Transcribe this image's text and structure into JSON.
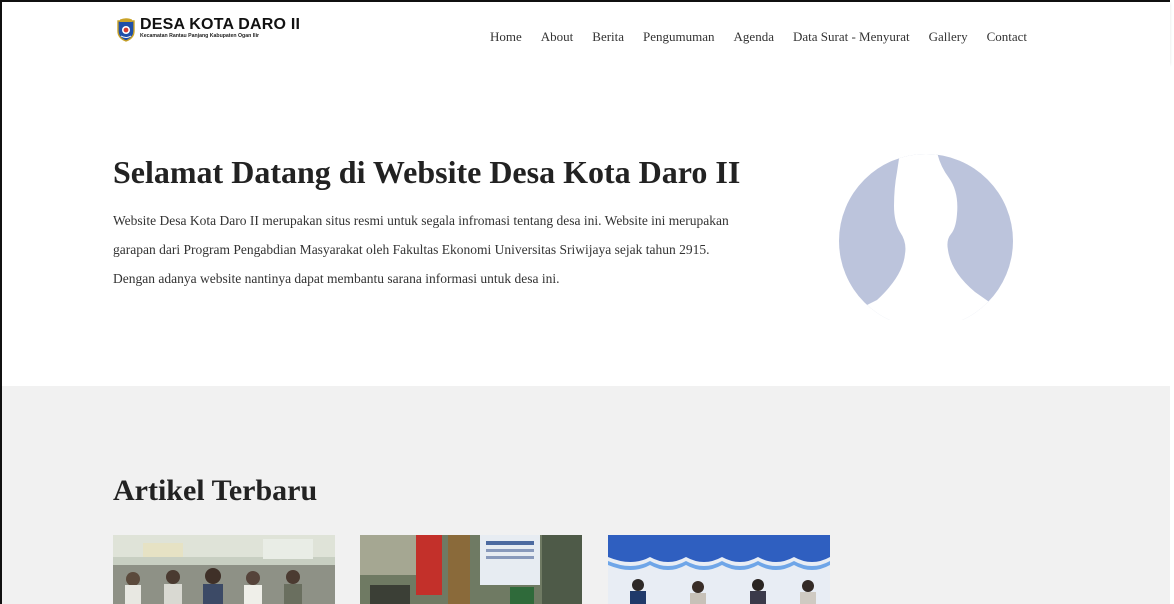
{
  "brand": {
    "title": "DESA KOTA DARO II",
    "subtitle": "Kecamatan Rantau Panjang Kabupaten Ogan Ilir"
  },
  "nav": {
    "items": [
      "Home",
      "About",
      "Berita",
      "Pengumuman",
      "Agenda",
      "Data Surat - Menyurat",
      "Gallery",
      "Contact"
    ]
  },
  "hero": {
    "title": "Selamat Datang di Website Desa Kota Daro II",
    "text": "Website Desa Kota Daro II merupakan situs resmi untuk segala infromasi tentang desa ini. Website ini merupakan garapan dari Program Pengabdian Masyarakat oleh Fakultas Ekonomi Universitas Sriwijaya sejak tahun 2915. Dengan adanya website nantinya dapat membantu sarana informasi untuk desa ini."
  },
  "articles": {
    "title": "Artikel Terbaru"
  },
  "colors": {
    "avatar": "#bcc4dc",
    "section_bg": "#f1f1f1",
    "logo_blue": "#1f4fa8"
  }
}
